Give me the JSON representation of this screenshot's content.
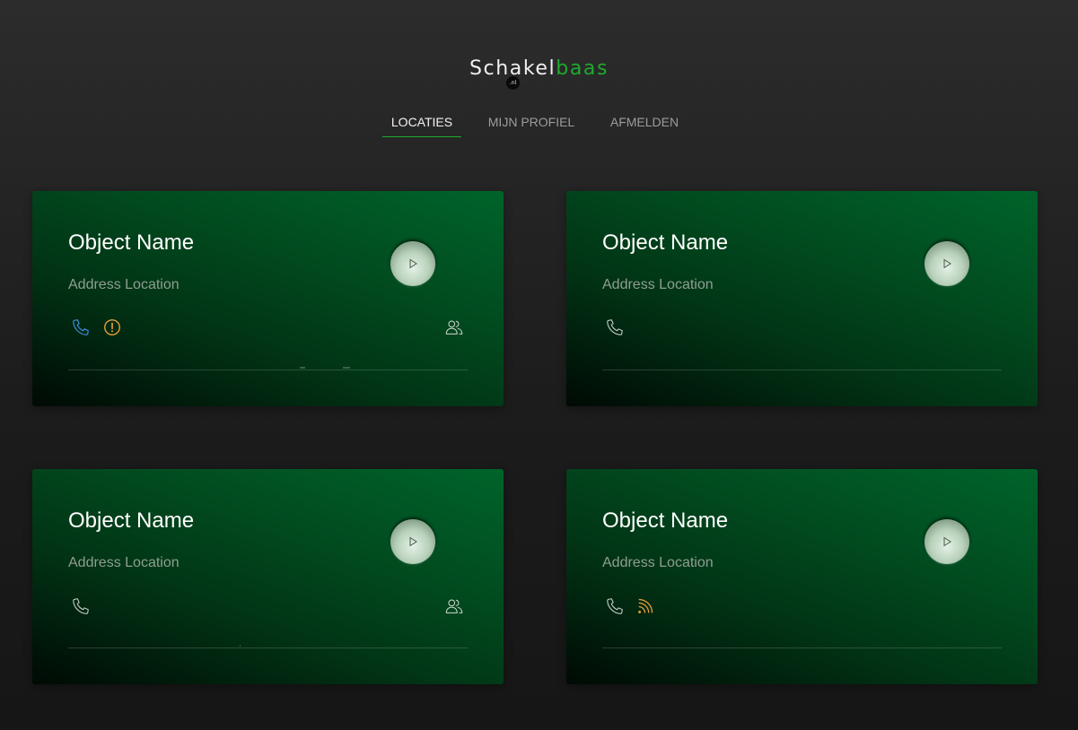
{
  "logo": {
    "part1": "Schakel",
    "part2": "baas",
    "badge": ".nl"
  },
  "nav": {
    "items": [
      {
        "label": "LOCATIES",
        "active": true
      },
      {
        "label": "MIJN PROFIEL",
        "active": false
      },
      {
        "label": "AFMELDEN",
        "active": false
      }
    ]
  },
  "colors": {
    "accent": "#1eab2f",
    "phone_active": "#3a8fd6",
    "warning": "#e8a13a",
    "feed": "#e8a13a"
  },
  "cards": [
    {
      "title": "Object Name",
      "address": "Address Location",
      "icons": [
        "phone-icon-blue",
        "warning-icon",
        "users-icon"
      ]
    },
    {
      "title": "Object Name",
      "address": "Address Location",
      "icons": [
        "phone-icon"
      ]
    },
    {
      "title": "Object Name",
      "address": "Address Location",
      "icons": [
        "phone-icon",
        "users-icon"
      ]
    },
    {
      "title": "Object Name",
      "address": "Address Location",
      "icons": [
        "phone-icon",
        "rss-icon"
      ]
    }
  ]
}
